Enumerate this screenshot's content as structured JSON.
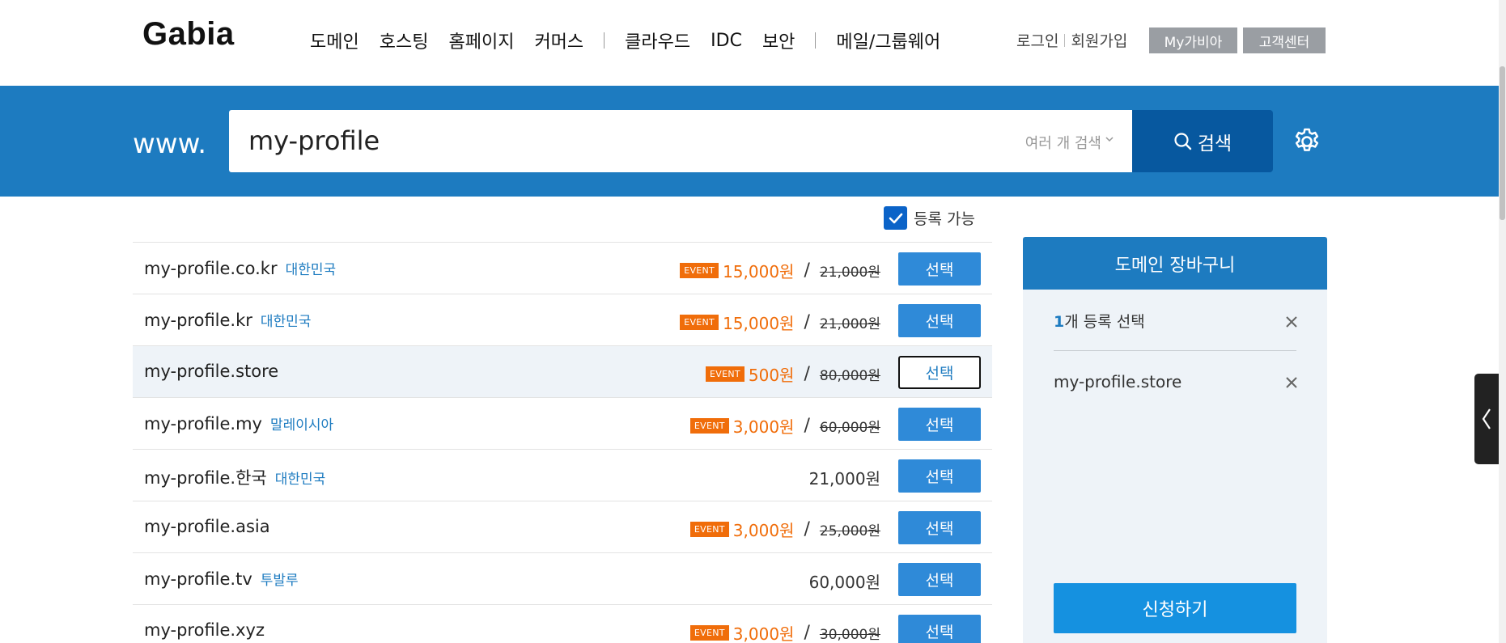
{
  "header": {
    "logo": "Gabia",
    "nav": [
      {
        "label": "도메인"
      },
      {
        "label": "호스팅"
      },
      {
        "label": "홈페이지"
      },
      {
        "label": "커머스"
      },
      {
        "sep": true
      },
      {
        "label": "클라우드"
      },
      {
        "label": "IDC"
      },
      {
        "label": "보안"
      },
      {
        "sep": true
      },
      {
        "label": "메일/그룹웨어"
      }
    ],
    "login": "로그인",
    "signup": "회원가입",
    "mygabia": "My가비아",
    "support": "고객센터"
  },
  "search": {
    "prefix": "www.",
    "query": "my-profile",
    "multi_label": "여러 개 검색",
    "button_label": "검색"
  },
  "filter": {
    "label": "등록 가능",
    "checked": true
  },
  "results": [
    {
      "domain": "my-profile.co.kr",
      "country": "대한민국",
      "event": true,
      "price": "15,000원",
      "original": "21,000원",
      "button": "선택",
      "selected": false
    },
    {
      "domain": "my-profile.kr",
      "country": "대한민국",
      "event": true,
      "price": "15,000원",
      "original": "21,000원",
      "button": "선택",
      "selected": false
    },
    {
      "domain": "my-profile.store",
      "country": "",
      "event": true,
      "price": "500원",
      "original": "80,000원",
      "button": "선택",
      "selected": true
    },
    {
      "domain": "my-profile.my",
      "country": "말레이시아",
      "event": true,
      "price": "3,000원",
      "original": "60,000원",
      "button": "선택",
      "selected": false
    },
    {
      "domain": "my-profile.한국",
      "country": "대한민국",
      "event": false,
      "price": "21,000원",
      "original": "",
      "button": "선택",
      "selected": false
    },
    {
      "domain": "my-profile.asia",
      "country": "",
      "event": true,
      "price": "3,000원",
      "original": "25,000원",
      "button": "선택",
      "selected": false
    },
    {
      "domain": "my-profile.tv",
      "country": "투발루",
      "event": false,
      "price": "60,000원",
      "original": "",
      "button": "선택",
      "selected": false
    },
    {
      "domain": "my-profile.xyz",
      "country": "",
      "event": true,
      "price": "3,000원",
      "original": "30,000원",
      "button": "선택",
      "selected": false
    }
  ],
  "event_badge": "EVENT",
  "price_slash": "/",
  "cart": {
    "title": "도메인 장바구니",
    "count_number": "1",
    "count_text": "개 등록 선택",
    "items": [
      "my-profile.store"
    ],
    "apply_label": "신청하기"
  },
  "colors": {
    "brand_blue": "#1d7bc0",
    "search_button": "#07589f",
    "event_orange": "#f06d0a",
    "select_button": "#2f8ad8"
  },
  "icons": {
    "search": "search-icon",
    "gear": "gear-icon",
    "close": "close-icon",
    "chevron_down": "chevron-down-icon",
    "chevron_left": "chevron-left-icon",
    "checkmark": "checkmark-icon"
  }
}
